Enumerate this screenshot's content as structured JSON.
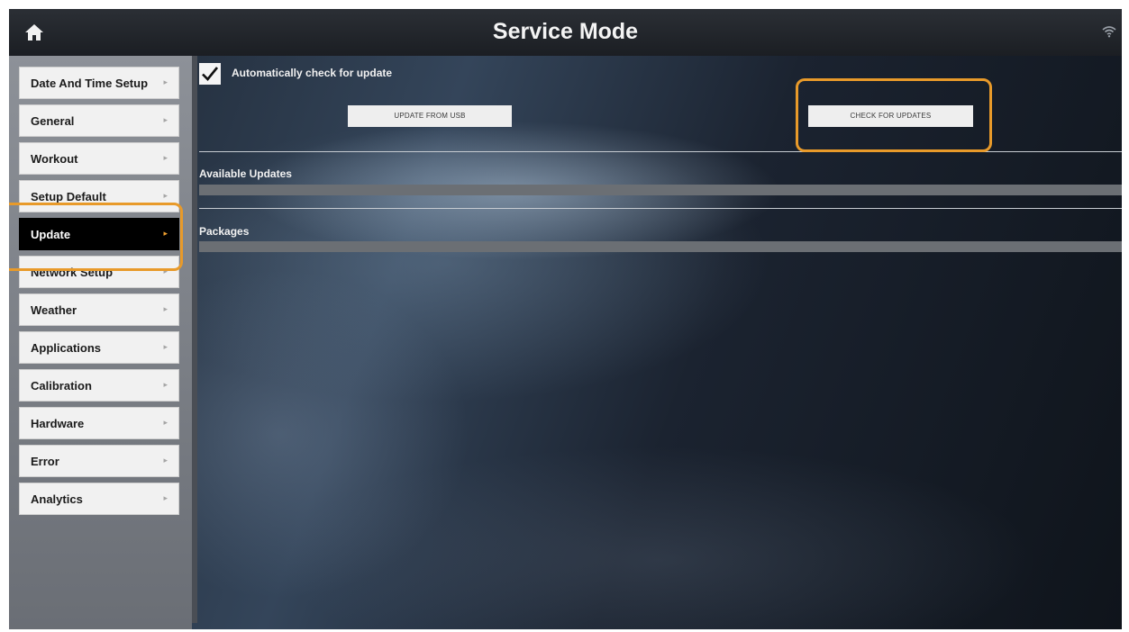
{
  "header": {
    "title": "Service Mode",
    "home_icon": "home-icon",
    "wifi_icon": "wifi-icon"
  },
  "sidebar": {
    "items": [
      {
        "label": "Date And Time Setup",
        "active": false
      },
      {
        "label": "General",
        "active": false
      },
      {
        "label": "Workout",
        "active": false
      },
      {
        "label": "Setup Default",
        "active": false
      },
      {
        "label": "Update",
        "active": true
      },
      {
        "label": "Network Setup",
        "active": false
      },
      {
        "label": "Weather",
        "active": false
      },
      {
        "label": "Applications",
        "active": false
      },
      {
        "label": "Calibration",
        "active": false
      },
      {
        "label": "Hardware",
        "active": false
      },
      {
        "label": "Error",
        "active": false
      },
      {
        "label": "Analytics",
        "active": false
      }
    ]
  },
  "main": {
    "auto_check": {
      "label": "Automatically check for update",
      "checked": true
    },
    "update_usb_label": "UPDATE FROM USB",
    "check_updates_label": "CHECK FOR UPDATES",
    "available_updates_title": "Available Updates",
    "packages_title": "Packages"
  },
  "colors": {
    "highlight": "#e89a2a",
    "active_chevron": "#f0a030"
  }
}
